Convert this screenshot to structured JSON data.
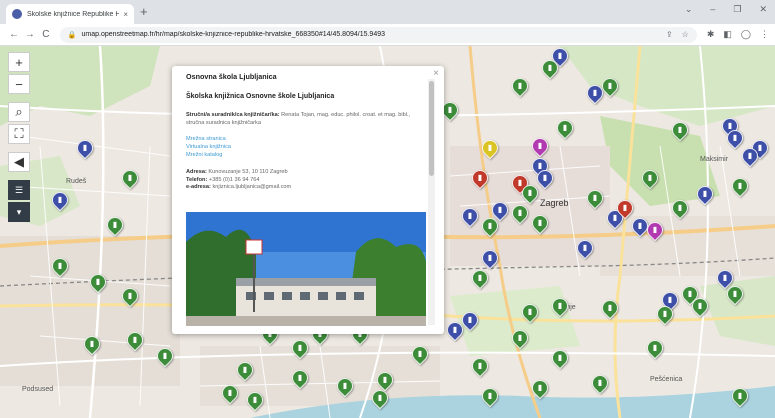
{
  "browser": {
    "tab_title": "Školske knjižnice Republike Hrvat",
    "tab_close": "×",
    "new_tab": "+",
    "window_controls": [
      "⌄",
      "–",
      "❐",
      "✕"
    ],
    "nav": [
      "←",
      "→",
      "C"
    ],
    "url": "umap.openstreetmap.fr/hr/map/skolske-knjiznice-republike-hrvatske_668350#14/45.8094/15.9493",
    "lock_icon": "lock-icon",
    "omnibox_icons": [
      "⇪",
      "☆"
    ],
    "toolbar_icons": [
      "✱",
      "◧",
      "◯",
      "⋮"
    ]
  },
  "map_controls": {
    "zoom_in": "+",
    "zoom_out": "−",
    "search": "⌕",
    "fullscreen": "⛶",
    "locate": "◀",
    "layers": "☰",
    "more": "▾"
  },
  "map": {
    "city_label": "Zagreb",
    "place_labels": [
      "Rudeš",
      "Podsused",
      "Trnje",
      "Maksimir",
      "Pešćenica"
    ],
    "colors": {
      "green_marker": "#3c8c3a",
      "blue_marker": "#3e4fa8",
      "red_marker": "#c0392b",
      "yellow_marker": "#d9c424",
      "magenta_marker": "#b23ab0"
    }
  },
  "popup": {
    "title": "Osnovna škola Ljubljanica",
    "subtitle": "Školska knjižnica Osnovne škole Ljubljanica",
    "staff_label": "Stručni/a suradnik/ca knjižničar/ka:",
    "staff_value": "Renata Tojan, mag. educ. philol. croat. et mag. bibl., stručna suradnica knjižničarka",
    "links": [
      "Mrežna stranica",
      "Virtualna knjižnica",
      "Mrežni katalog"
    ],
    "address_label": "Adresa:",
    "address_value": "Kunovuzanje 53, 10 110 Zagreb",
    "phone_label": "Telefon:",
    "phone_value": "+385 (0)1 36 94 764",
    "email_label": "e-adresa:",
    "email_value": "knjiznica.ljubljanica@gmail.com",
    "close": "×"
  }
}
